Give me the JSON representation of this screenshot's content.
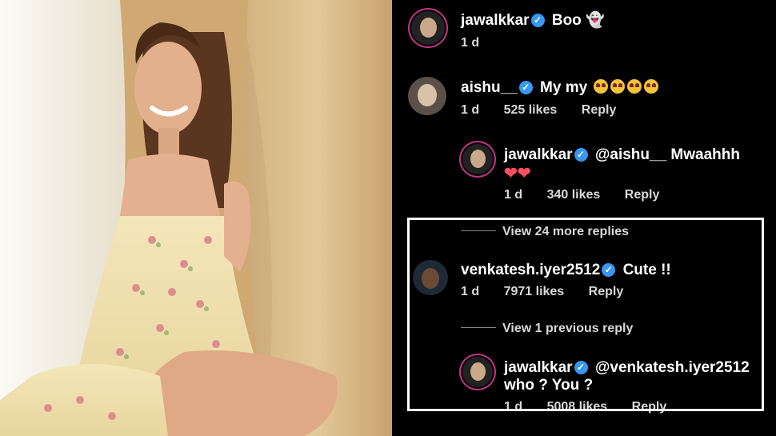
{
  "photo": {
    "alt_icon": "portrait-photo"
  },
  "comments": [
    {
      "user": "jawalkkar",
      "text": "Boo 👻",
      "time": "1 d",
      "likes": "",
      "reply": ""
    },
    {
      "user": "aishu__",
      "text": "My my",
      "emoji_count": 4,
      "time": "1 d",
      "likes": "525 likes",
      "reply": "Reply"
    },
    {
      "user": "jawalkkar",
      "text": "@aishu__  Mwaahhh",
      "text2": "❤❤",
      "time": "1 d",
      "likes": "340 likes",
      "reply": "Reply"
    },
    {
      "user": "venkatesh.iyer2512",
      "text": "Cute !!",
      "time": "1 d",
      "likes": "7971 likes",
      "reply": "Reply"
    },
    {
      "user": "jawalkkar",
      "text": "@venkatesh.iyer2512",
      "text2": "who ? You ?",
      "time": "1 d",
      "likes": "5008 likes",
      "reply": "Reply"
    }
  ],
  "view_more": "View 24 more replies",
  "view_previous": "View 1 previous reply",
  "colors": {
    "verified": "#3897f0",
    "story_ring": "#c13584",
    "highlight_border": "#ffffff"
  }
}
